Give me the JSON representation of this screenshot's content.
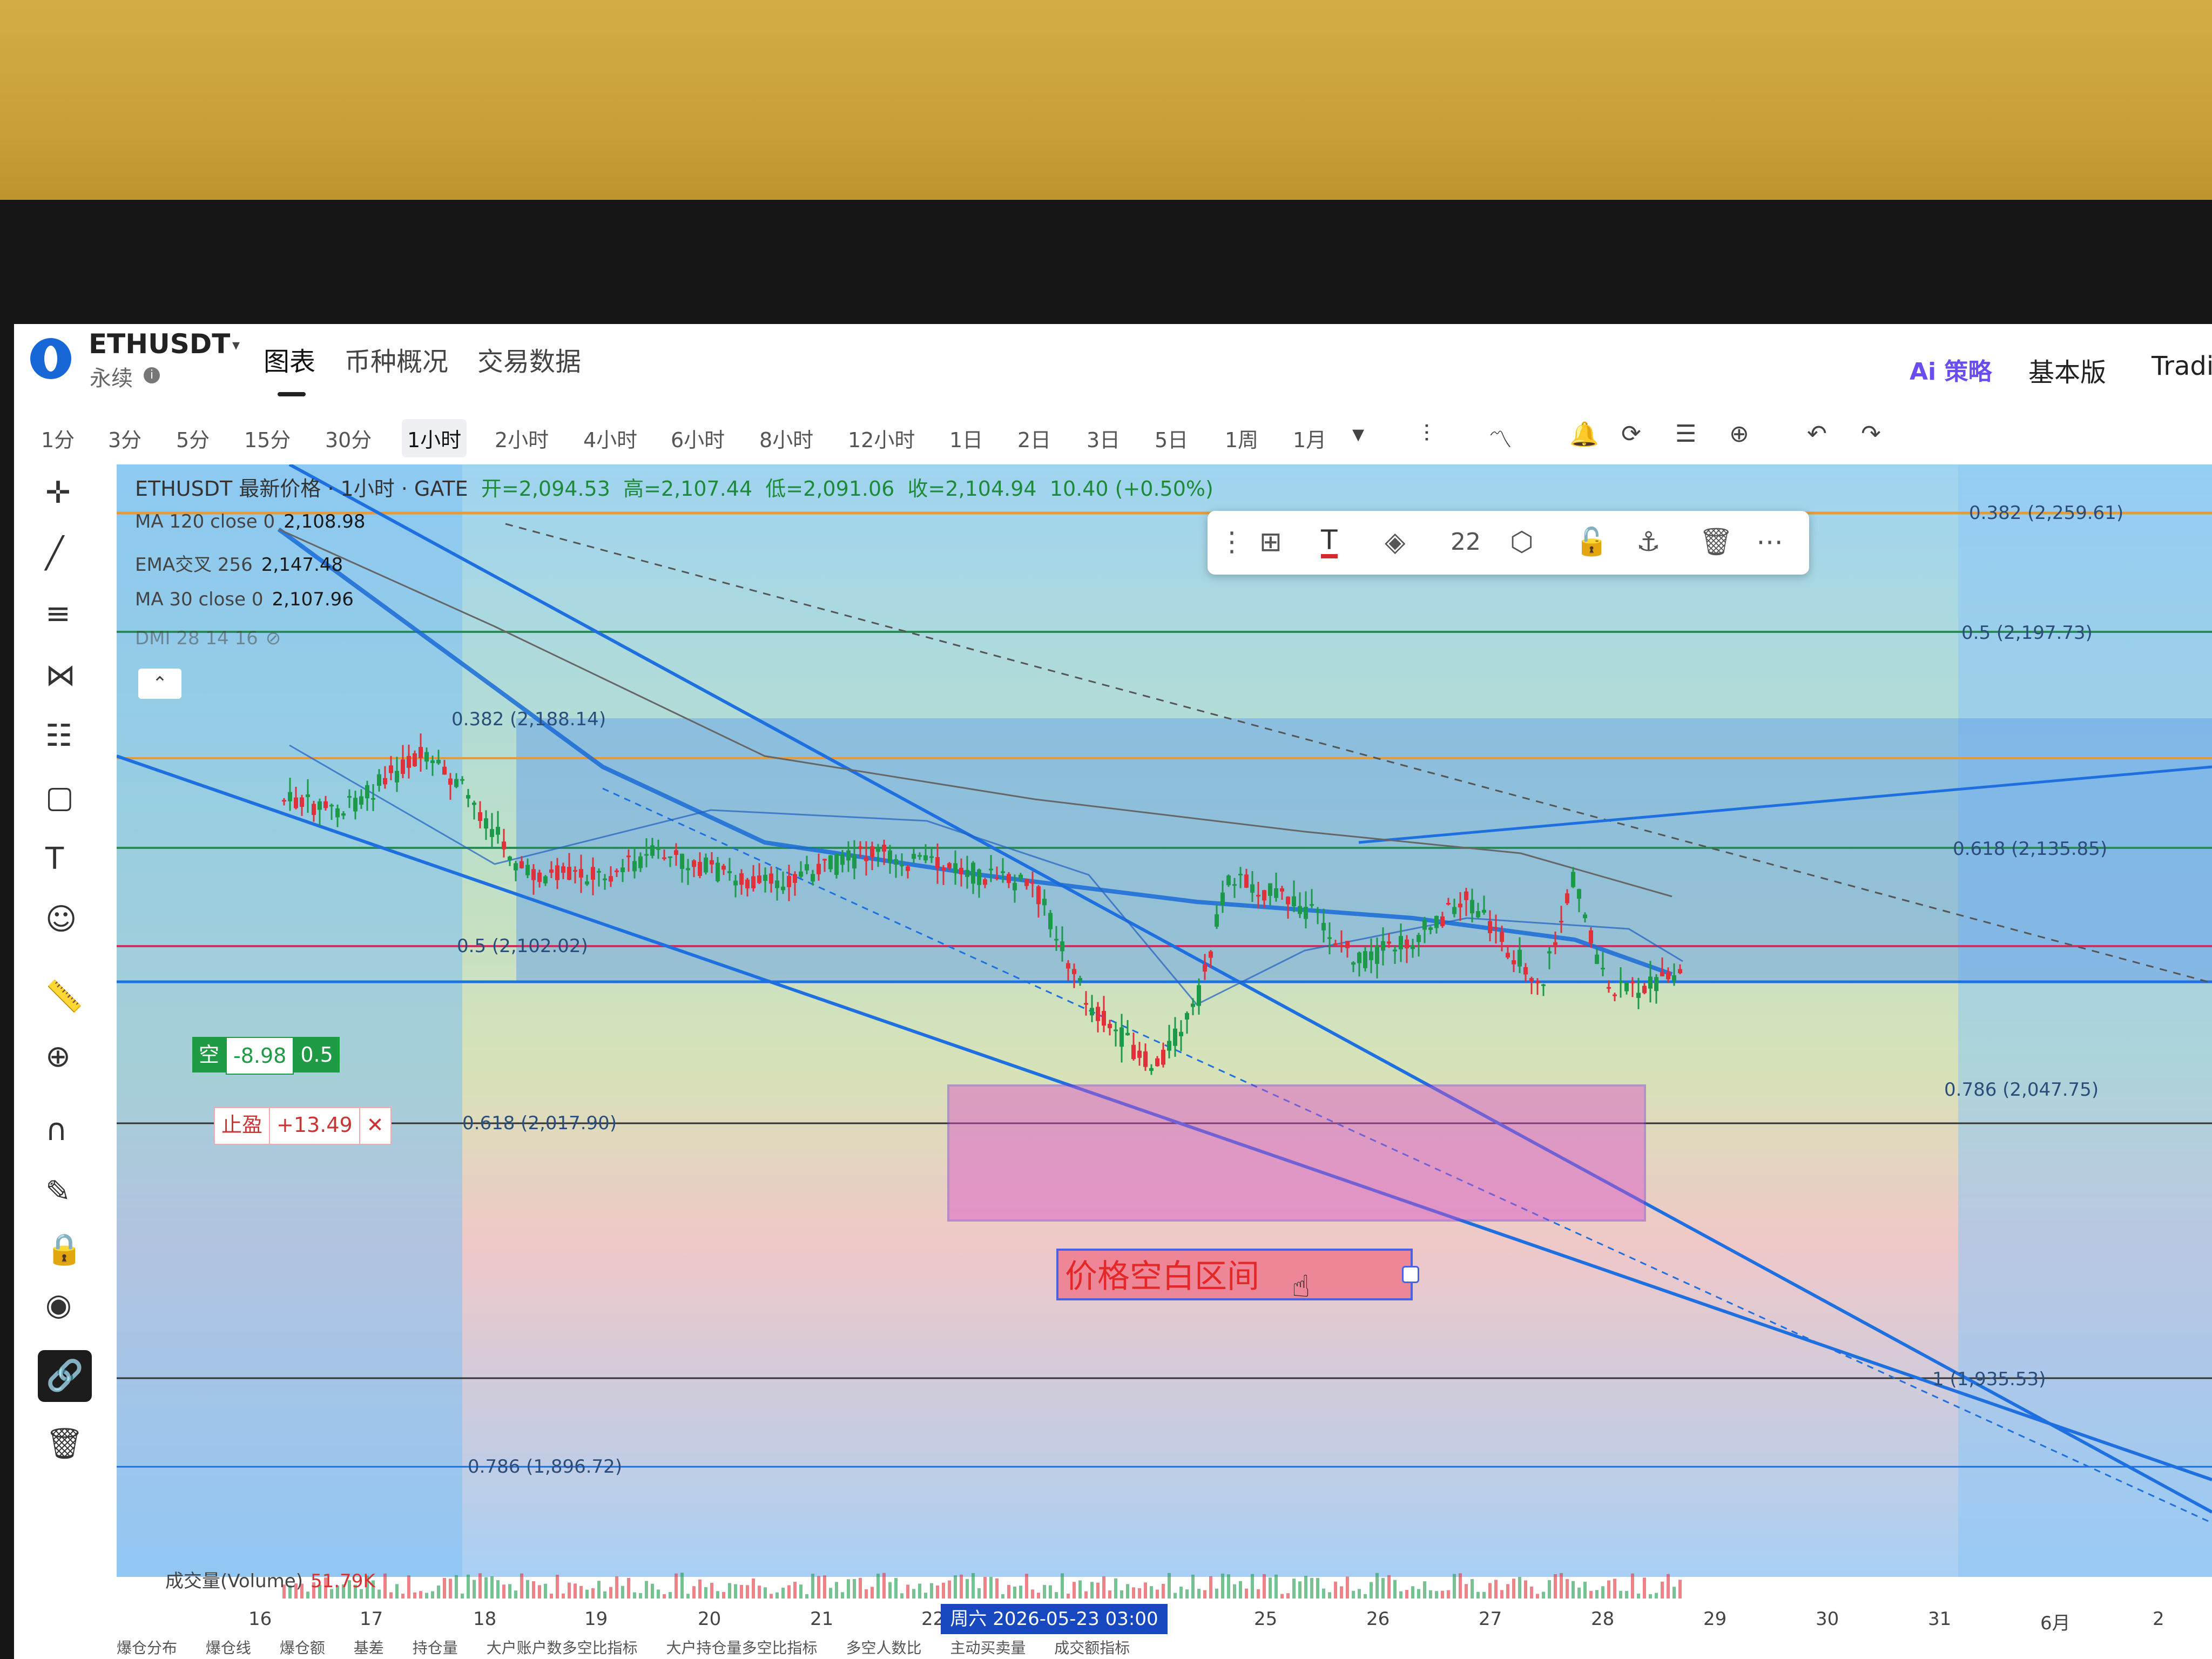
{
  "header": {
    "symbol": "ETHUSDT",
    "contract_type": "永续",
    "tabs": [
      "图表",
      "币种概况",
      "交易数据"
    ],
    "ai_strategy": "Ai 策略",
    "basic_version": "基本版",
    "trading_view": "Tradi"
  },
  "timeframes": [
    "1分",
    "3分",
    "5分",
    "15分",
    "30分",
    "1小时",
    "2小时",
    "4小时",
    "6小时",
    "8小时",
    "12小时",
    "1日",
    "2日",
    "3日",
    "5日",
    "1周",
    "1月"
  ],
  "active_timeframe": "1小时",
  "legend": {
    "title": "ETHUSDT 最新价格 · 1小时 · GATE",
    "open": "开=2,094.53",
    "high": "高=2,107.44",
    "low": "低=2,091.06",
    "close": "收=2,104.94",
    "change": "10.40 (+0.50%)"
  },
  "indicators": [
    {
      "label": "MA 120 close 0",
      "value": "2,108.98"
    },
    {
      "label": "EMA交叉 256",
      "value": "2,147.48"
    },
    {
      "label": "MA 30 close 0",
      "value": "2,107.96"
    },
    {
      "label": "DMI 28 14 16",
      "value": ""
    }
  ],
  "floating_toolbar": {
    "font_size": "22"
  },
  "fib_levels": [
    {
      "label": "0.382 (2,259.61)"
    },
    {
      "label": "0.5 (2,197.73)"
    },
    {
      "label": "0.618 (2,135.85)"
    },
    {
      "label": "0.786 (2,047.75)"
    },
    {
      "label": "1 (1,935.53)"
    },
    {
      "label": "0.382 (2,188.14)"
    },
    {
      "label": "0.5 (2,102.02)"
    },
    {
      "label": "0.618 (2,017.90)"
    },
    {
      "label": "0.786 (1,896.72)"
    }
  ],
  "position": {
    "side": "空",
    "pnl": "-8.98",
    "size": "0.5",
    "take_profit_label": "止盈",
    "take_profit_value": "+13.49",
    "close_icon": "close-icon"
  },
  "annotation": {
    "text": "价格空白区间"
  },
  "volume": {
    "label": "成交量(Volume)",
    "value": "51.79K"
  },
  "x_axis": [
    "16",
    "17",
    "18",
    "19",
    "20",
    "21",
    "22",
    "25",
    "26",
    "27",
    "28",
    "29",
    "30",
    "31",
    "6月",
    "2"
  ],
  "cursor_date": "周六 2026-05-23   03:00",
  "bottom_tabs": [
    "爆仓分布",
    "爆仓线",
    "爆仓额",
    "基差",
    "持仓量",
    "大户账户数多空比指标",
    "大户持仓量多空比指标",
    "多空人数比",
    "主动买卖量",
    "成交额指标"
  ],
  "colors": {
    "channel_blue": "#1e6fe0",
    "zone_magenta": "#d94fc9",
    "candle_up": "#1c9a4a",
    "candle_down": "#e0303a",
    "position_green": "#1f9a45"
  }
}
